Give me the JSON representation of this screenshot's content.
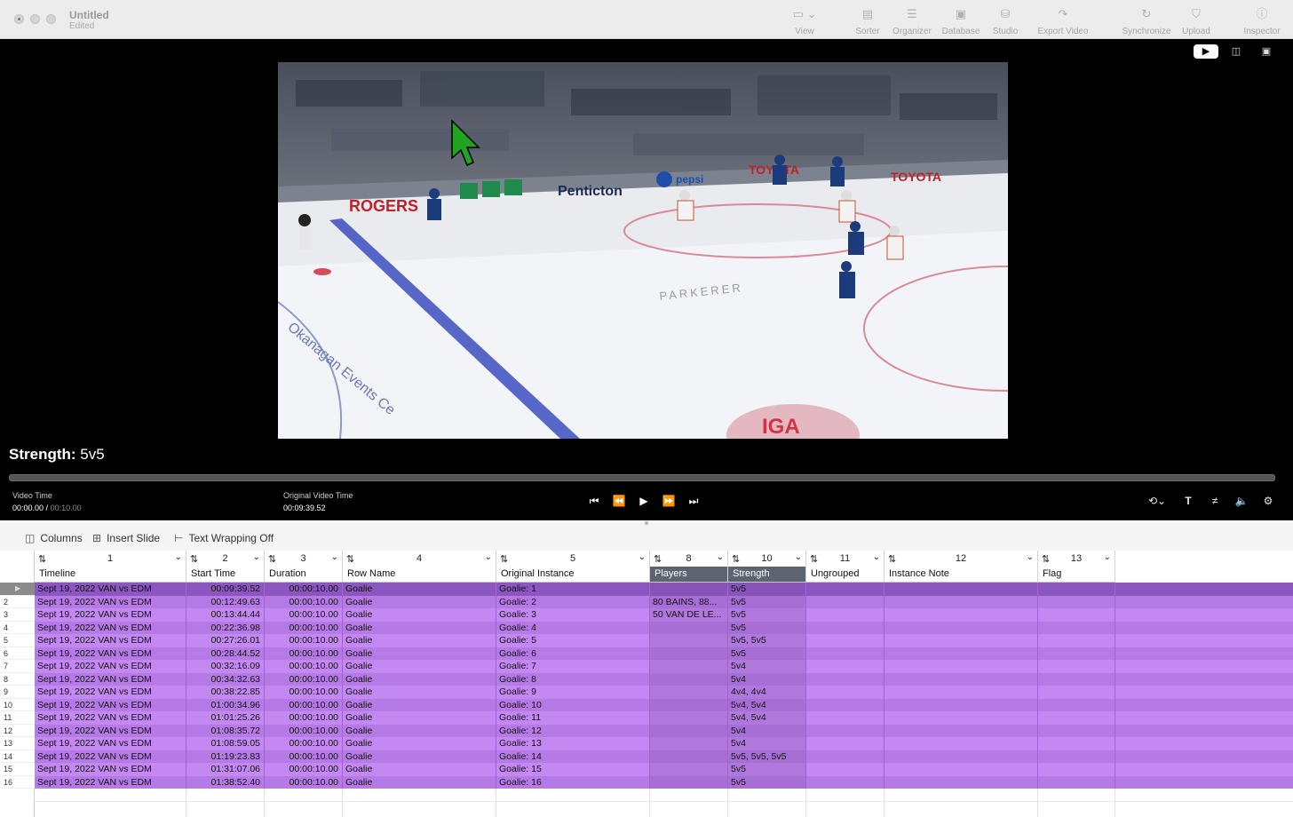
{
  "window": {
    "title": "Untitled",
    "subtitle": "Edited"
  },
  "toolbar": {
    "items": [
      {
        "label": "View",
        "icon": "view-icon",
        "glyph": "▭ ⌄"
      },
      {
        "label": "Sorter",
        "icon": "sorter-icon",
        "glyph": "▤"
      },
      {
        "label": "Organizer",
        "icon": "organizer-icon",
        "glyph": "☰"
      },
      {
        "label": "Database",
        "icon": "database-icon",
        "glyph": "▣"
      },
      {
        "label": "Studio",
        "icon": "studio-icon",
        "glyph": "⛁"
      },
      {
        "label": "Export Video",
        "icon": "export-icon",
        "glyph": "↷"
      },
      {
        "label": "Synchronize",
        "icon": "synchronize-icon",
        "glyph": "↻"
      },
      {
        "label": "Upload",
        "icon": "upload-icon",
        "glyph": "⛉"
      },
      {
        "label": "Inspector",
        "icon": "inspector-icon",
        "glyph": "ⓘ"
      }
    ]
  },
  "player": {
    "caption_label": "Strength:",
    "caption_value": "5v5",
    "video_time_label": "Video Time",
    "video_time_current": "00:00.00",
    "video_time_separator": " / ",
    "video_time_total": "00:10.00",
    "original_time_label": "Original Video Time",
    "original_time_value": "00:09:39.52",
    "transport": [
      "skip-to-start-icon",
      "rewind-icon",
      "play-icon",
      "fast-forward-icon",
      "skip-to-end-icon"
    ],
    "right_controls": [
      "loop-icon",
      "text-icon",
      "strikethrough-icon",
      "volume-icon",
      "settings-icon"
    ]
  },
  "table_toolbar": {
    "columns_label": "Columns",
    "insert_slide_label": "Insert Slide",
    "text_wrapping_label": "Text Wrapping Off"
  },
  "table": {
    "control_numbers": [
      "1",
      "2",
      "3",
      "4",
      "5",
      "8",
      "10",
      "11",
      "12",
      "13"
    ],
    "headers": [
      "Timeline",
      "Start Time",
      "Duration",
      "Row Name",
      "Original Instance",
      "Players",
      "Strength",
      "Ungrouped",
      "Instance Note",
      "Flag"
    ],
    "rows": [
      {
        "n": "▶",
        "timeline": "Sept 19, 2022 VAN vs EDM",
        "start": "00:09:39.52",
        "duration": "00:00:10.00",
        "row_name": "Goalie",
        "instance": "Goalie: 1",
        "players": "",
        "strength": "5v5"
      },
      {
        "n": "2",
        "timeline": "Sept 19, 2022 VAN vs EDM",
        "start": "00:12:49.63",
        "duration": "00:00:10.00",
        "row_name": "Goalie",
        "instance": "Goalie: 2",
        "players": "80 BAINS, 88...",
        "strength": "5v5"
      },
      {
        "n": "3",
        "timeline": "Sept 19, 2022 VAN vs EDM",
        "start": "00:13:44.44",
        "duration": "00:00:10.00",
        "row_name": "Goalie",
        "instance": "Goalie: 3",
        "players": "50 VAN DE LE...",
        "strength": "5v5"
      },
      {
        "n": "4",
        "timeline": "Sept 19, 2022 VAN vs EDM",
        "start": "00:22:36.98",
        "duration": "00:00:10.00",
        "row_name": "Goalie",
        "instance": "Goalie: 4",
        "players": "",
        "strength": "5v5"
      },
      {
        "n": "5",
        "timeline": "Sept 19, 2022 VAN vs EDM",
        "start": "00:27:26.01",
        "duration": "00:00:10.00",
        "row_name": "Goalie",
        "instance": "Goalie: 5",
        "players": "",
        "strength": "5v5, 5v5"
      },
      {
        "n": "6",
        "timeline": "Sept 19, 2022 VAN vs EDM",
        "start": "00:28:44.52",
        "duration": "00:00:10.00",
        "row_name": "Goalie",
        "instance": "Goalie: 6",
        "players": "",
        "strength": "5v5"
      },
      {
        "n": "7",
        "timeline": "Sept 19, 2022 VAN vs EDM",
        "start": "00:32:16.09",
        "duration": "00:00:10.00",
        "row_name": "Goalie",
        "instance": "Goalie: 7",
        "players": "",
        "strength": "5v4"
      },
      {
        "n": "8",
        "timeline": "Sept 19, 2022 VAN vs EDM",
        "start": "00:34:32.63",
        "duration": "00:00:10.00",
        "row_name": "Goalie",
        "instance": "Goalie: 8",
        "players": "",
        "strength": "5v4"
      },
      {
        "n": "9",
        "timeline": "Sept 19, 2022 VAN vs EDM",
        "start": "00:38:22.85",
        "duration": "00:00:10.00",
        "row_name": "Goalie",
        "instance": "Goalie: 9",
        "players": "",
        "strength": "4v4, 4v4"
      },
      {
        "n": "10",
        "timeline": "Sept 19, 2022 VAN vs EDM",
        "start": "01:00:34.96",
        "duration": "00:00:10.00",
        "row_name": "Goalie",
        "instance": "Goalie: 10",
        "players": "",
        "strength": "5v4, 5v4"
      },
      {
        "n": "11",
        "timeline": "Sept 19, 2022 VAN vs EDM",
        "start": "01:01:25.26",
        "duration": "00:00:10.00",
        "row_name": "Goalie",
        "instance": "Goalie: 11",
        "players": "",
        "strength": "5v4, 5v4"
      },
      {
        "n": "12",
        "timeline": "Sept 19, 2022 VAN vs EDM",
        "start": "01:08:35.72",
        "duration": "00:00:10.00",
        "row_name": "Goalie",
        "instance": "Goalie: 12",
        "players": "",
        "strength": "5v4"
      },
      {
        "n": "13",
        "timeline": "Sept 19, 2022 VAN vs EDM",
        "start": "01:08:59.05",
        "duration": "00:00:10.00",
        "row_name": "Goalie",
        "instance": "Goalie: 13",
        "players": "",
        "strength": "5v4"
      },
      {
        "n": "14",
        "timeline": "Sept 19, 2022 VAN vs EDM",
        "start": "01:19:23.83",
        "duration": "00:00:10.00",
        "row_name": "Goalie",
        "instance": "Goalie: 14",
        "players": "",
        "strength": "5v5, 5v5, 5v5"
      },
      {
        "n": "15",
        "timeline": "Sept 19, 2022 VAN vs EDM",
        "start": "01:31:07.06",
        "duration": "00:00:10.00",
        "row_name": "Goalie",
        "instance": "Goalie: 15",
        "players": "",
        "strength": "5v5"
      },
      {
        "n": "16",
        "timeline": "Sept 19, 2022 VAN vs EDM",
        "start": "01:38:52.40",
        "duration": "00:00:10.00",
        "row_name": "Goalie",
        "instance": "Goalie: 16",
        "players": "",
        "strength": "5v5"
      }
    ]
  },
  "frame_text": {
    "board_rogers": "ROGERS",
    "board_penticton": "Penticton",
    "board_pepsi": "pepsi",
    "board_toyota_1": "TOYOTA",
    "board_toyota_2": "TOYOTA",
    "ice_text_1": "PARKERER",
    "ice_text_2": "Okanagan Events Ce",
    "ice_logo": "IGA"
  },
  "colors": {
    "row_selected": "#8c56c0",
    "row_odd": "#b67ae6",
    "row_even": "#c388f2",
    "header_selected": "#5b6470",
    "cursor": "#22a322"
  }
}
